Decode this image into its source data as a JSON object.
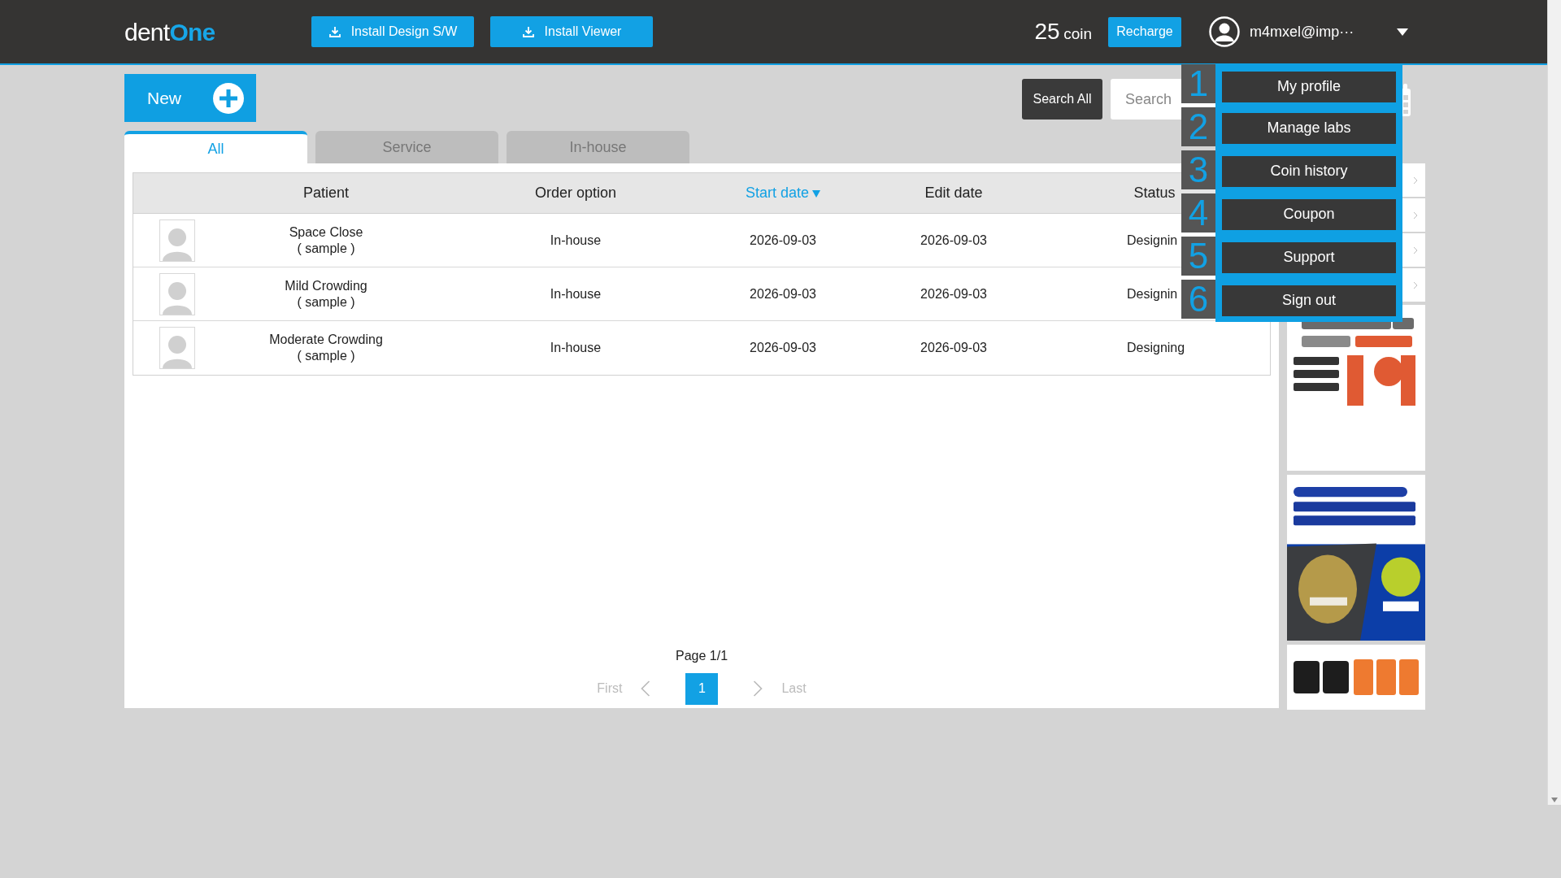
{
  "header": {
    "logo": [
      "dent",
      "One"
    ],
    "install_buttons": [
      "Install Design S/W",
      "Install Viewer"
    ],
    "coin_amount": "25",
    "coin_unit": "coin",
    "recharge": "Recharge",
    "user": "m4mxel@imp···"
  },
  "new_button": "New",
  "search": {
    "button": "Search All",
    "placeholder": "Search"
  },
  "user_menu": {
    "expanded": true,
    "items": [
      {
        "number": "1",
        "label": "My profile"
      },
      {
        "number": "2",
        "label": "Manage labs"
      },
      {
        "number": "3",
        "label": "Coin history"
      },
      {
        "number": "4",
        "label": "Coupon"
      },
      {
        "number": "5",
        "label": "Support"
      },
      {
        "number": "6",
        "label": "Sign out"
      }
    ]
  },
  "tabs": [
    {
      "label": "All",
      "selected": true
    },
    {
      "label": "Service",
      "selected": false
    },
    {
      "label": "In-house",
      "selected": false
    }
  ],
  "table": {
    "columns": [
      {
        "label": "Patient",
        "sorted": false
      },
      {
        "label": "Order option",
        "sorted": false
      },
      {
        "label": "Start date",
        "sorted": true
      },
      {
        "label": "Edit date",
        "sorted": false
      },
      {
        "label": "Status",
        "sorted": false
      }
    ],
    "rows": [
      {
        "patient": "Space Close",
        "note": "( sample )",
        "order_option": "In-house",
        "start_date": "2026-09-03",
        "edit_date": "2026-09-03",
        "status": "Designin"
      },
      {
        "patient": "Mild Crowding",
        "note": "( sample )",
        "order_option": "In-house",
        "start_date": "2026-09-03",
        "edit_date": "2026-09-03",
        "status": "Designin"
      },
      {
        "patient": "Moderate Crowding",
        "note": "( sample )",
        "order_option": "In-house",
        "start_date": "2026-09-03",
        "edit_date": "2026-09-03",
        "status": "Designing"
      }
    ]
  },
  "pagination": {
    "label": "Page 1/1",
    "first": "First",
    "last": "Last",
    "pages": [
      {
        "label": "1",
        "selected": true
      }
    ]
  },
  "side_links": [
    {
      "kind": "link"
    },
    {
      "kind": "link"
    },
    {
      "kind": "link"
    },
    {
      "kind": "link"
    }
  ]
}
